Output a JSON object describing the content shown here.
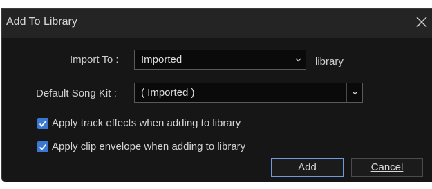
{
  "dialog": {
    "title": "Add To Library",
    "close_icon": "close-icon"
  },
  "import_to": {
    "label": "Import To :",
    "value": "Imported",
    "suffix": "library"
  },
  "default_song_kit": {
    "label": "Default Song Kit :",
    "value": "( Imported )"
  },
  "options": [
    {
      "label": "Apply track effects when adding to library",
      "checked": true
    },
    {
      "label": "Apply clip envelope when adding to library",
      "checked": true
    }
  ],
  "buttons": {
    "add_label": "Add",
    "cancel_label": "Cancel"
  },
  "colors": {
    "background": "#161616",
    "titlebar": "#242424",
    "accent": "#3a78d4",
    "text": "#d4d4d4"
  }
}
